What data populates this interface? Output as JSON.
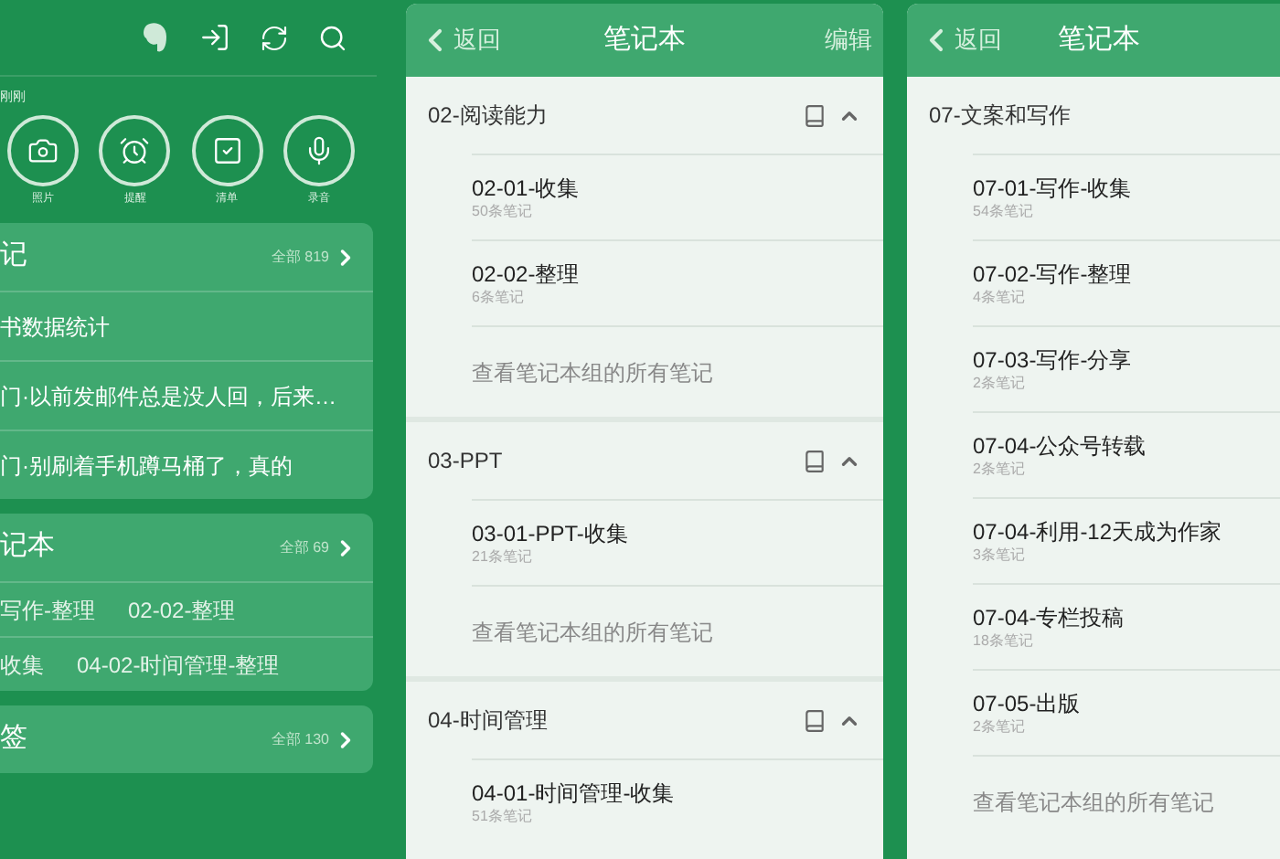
{
  "home": {
    "recent_label": "刚刚",
    "quick_actions": [
      {
        "label": "照片",
        "kind": "camera"
      },
      {
        "label": "提醒",
        "kind": "alarm"
      },
      {
        "label": "清单",
        "kind": "checklist"
      },
      {
        "label": "录音",
        "kind": "audio"
      }
    ],
    "sections": [
      {
        "title": "记",
        "count": "全部 819",
        "kind": "notes",
        "rows": [
          [
            "书数据统计"
          ],
          [
            "门·以前发邮件总是没人回，后来…"
          ],
          [
            "门·别刷着手机蹲马桶了，真的"
          ]
        ]
      },
      {
        "title": "记本",
        "count": "全部 69",
        "kind": "notebooks",
        "rows": [
          [
            "写作-整理",
            "02-02-整理"
          ],
          [
            "收集",
            "04-02-时间管理-整理"
          ]
        ]
      },
      {
        "title": "签",
        "count": "全部 130"
      }
    ]
  },
  "notebooks_screen": {
    "back": "返回",
    "title": "笔记本",
    "edit": "编辑",
    "groups": [
      {
        "name": "02-阅读能力",
        "expanded": true,
        "notebooks": [
          {
            "name": "02-01-收集",
            "count": "50条笔记"
          },
          {
            "name": "02-02-整理",
            "count": "6条笔记"
          }
        ],
        "view_all": "查看笔记本组的所有笔记"
      },
      {
        "name": "03-PPT",
        "expanded": true,
        "notebooks": [
          {
            "name": "03-01-PPT-收集",
            "count": "21条笔记"
          }
        ],
        "view_all": "查看笔记本组的所有笔记"
      },
      {
        "name": "04-时间管理",
        "expanded": true,
        "notebooks": [
          {
            "name": "04-01-时间管理-收集",
            "count": "51条笔记"
          }
        ]
      }
    ]
  },
  "notebooks_screen_2": {
    "back": "返回",
    "title": "笔记本",
    "groups": [
      {
        "name": "07-文案和写作",
        "notebooks": [
          {
            "name": "07-01-写作-收集",
            "count": "54条笔记"
          },
          {
            "name": "07-02-写作-整理",
            "count": "4条笔记"
          },
          {
            "name": "07-03-写作-分享",
            "count": "2条笔记"
          },
          {
            "name": "07-04-公众号转载",
            "count": "2条笔记"
          },
          {
            "name": "07-04-利用-12天成为作家",
            "count": "3条笔记"
          },
          {
            "name": "07-04-专栏投稿",
            "count": "18条笔记"
          },
          {
            "name": "07-05-出版",
            "count": "2条笔记"
          }
        ],
        "view_all": "查看笔记本组的所有笔记"
      }
    ]
  }
}
